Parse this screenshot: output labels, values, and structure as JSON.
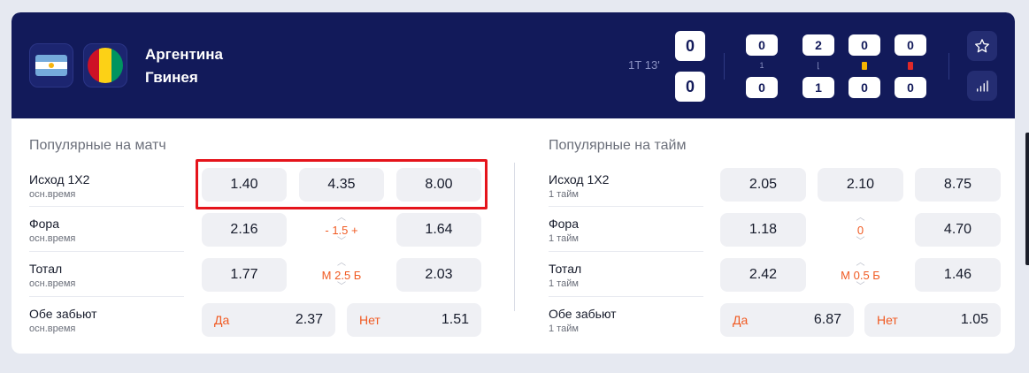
{
  "match": {
    "team1": "Аргентина",
    "team2": "Гвинея",
    "period": "1Т 13'",
    "score1": "0",
    "score2": "0",
    "stats": [
      {
        "top": "0",
        "bottom": "0",
        "label": "1",
        "icon": "period-label"
      },
      {
        "top": "2",
        "bottom": "1",
        "label": "⌊",
        "icon": "corner-icon"
      },
      {
        "top": "0",
        "bottom": "0",
        "label": "",
        "icon": "yellow-card-icon"
      },
      {
        "top": "0",
        "bottom": "0",
        "label": "",
        "icon": "red-card-icon"
      }
    ],
    "flags": {
      "team1": "argentina-flag",
      "team2": "guinea-flag"
    },
    "colors": {
      "header_bg": "#121a5a",
      "accent": "#f05a22",
      "highlight": "#e5141b",
      "yellow_card": "#f5b400",
      "red_card": "#e02929"
    }
  },
  "left": {
    "title": "Популярные на матч",
    "rows": [
      {
        "name": "Исход 1Х2",
        "sub": "осн.время",
        "odds": [
          "1.40",
          "4.35",
          "8.00"
        ]
      },
      {
        "name": "Фора",
        "sub": "осн.время",
        "odd1": "2.16",
        "mid": "- 1.5 +",
        "odd2": "1.64"
      },
      {
        "name": "Тотал",
        "sub": "осн.время",
        "odd1": "1.77",
        "mid": "М 2.5 Б",
        "odd2": "2.03"
      },
      {
        "name": "Обе забьют",
        "sub": "осн.время",
        "yes_label": "Да",
        "yes": "2.37",
        "no_label": "Нет",
        "no": "1.51"
      }
    ]
  },
  "right": {
    "title": "Популярные на тайм",
    "rows": [
      {
        "name": "Исход 1Х2",
        "sub": "1 тайм",
        "odds": [
          "2.05",
          "2.10",
          "8.75"
        ]
      },
      {
        "name": "Фора",
        "sub": "1 тайм",
        "odd1": "1.18",
        "mid": "0",
        "odd2": "4.70"
      },
      {
        "name": "Тотал",
        "sub": "1 тайм",
        "odd1": "2.42",
        "mid": "М 0.5 Б",
        "odd2": "1.46"
      },
      {
        "name": "Обе забьют",
        "sub": "1 тайм",
        "yes_label": "Да",
        "yes": "6.87",
        "no_label": "Нет",
        "no": "1.05"
      }
    ]
  },
  "icons": {
    "favorite": "star-icon",
    "stats": "bar-chart-icon",
    "up": "chevron-up-icon",
    "down": "chevron-down-icon"
  }
}
